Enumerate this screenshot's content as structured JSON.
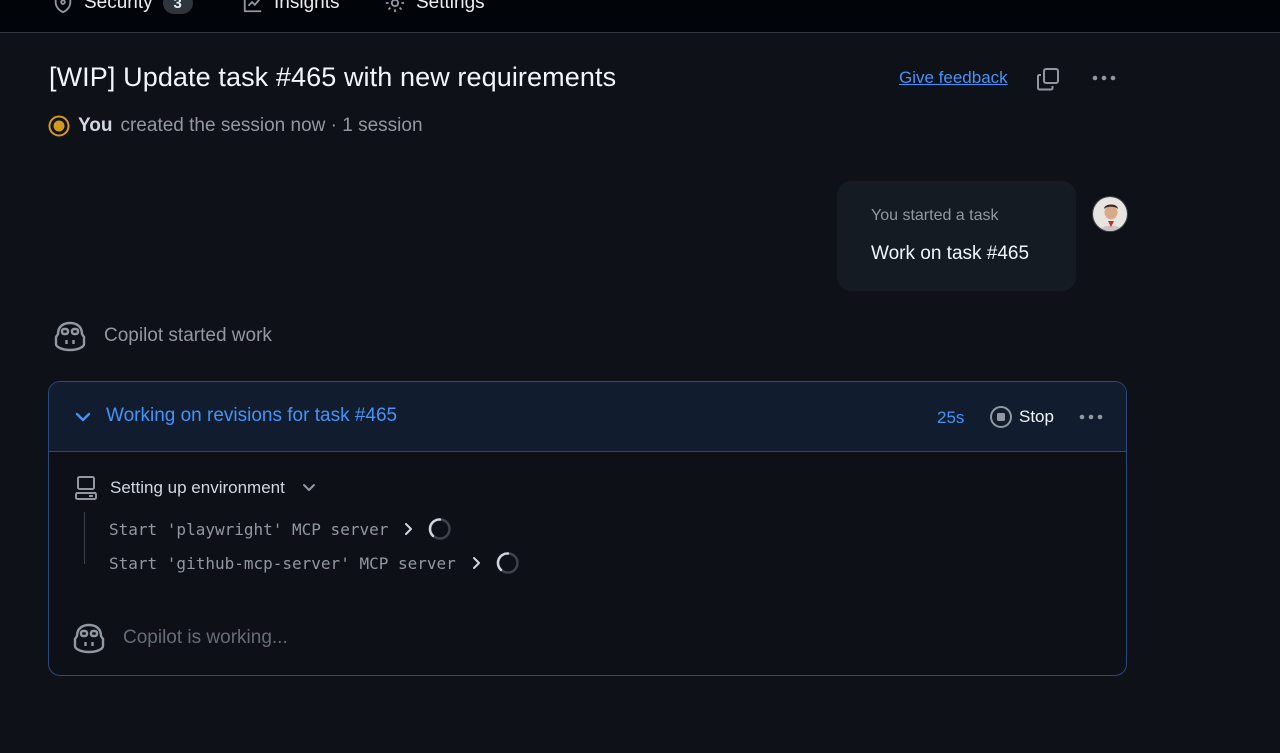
{
  "topnav": {
    "tabs": [
      {
        "label": "Security",
        "count": "3",
        "icon": "shield-icon"
      },
      {
        "label": "Insights",
        "icon": "graph-icon"
      },
      {
        "label": "Settings",
        "icon": "gear-icon"
      }
    ]
  },
  "header": {
    "title": "[WIP] Update task #465 with new requirements",
    "feedback_label": "Give feedback",
    "copy_icon": "copy-icon",
    "more_icon": "kebab-horizontal-icon"
  },
  "meta": {
    "actor": "You",
    "text": "created the session now · 1 session",
    "status_color": "#d29922"
  },
  "user_message": {
    "caption": "You started a task",
    "body": "Work on task #465"
  },
  "copilot_event": {
    "text": "Copilot started work"
  },
  "session": {
    "title": "Working on revisions for task #465",
    "elapsed": "25s",
    "stop_label": "Stop",
    "accent": "#4493f8",
    "group": {
      "label": "Setting up environment",
      "steps": [
        {
          "text": "Start 'playwright' MCP server"
        },
        {
          "text": "Start 'github-mcp-server' MCP server"
        }
      ]
    },
    "status": "Copilot is working..."
  }
}
